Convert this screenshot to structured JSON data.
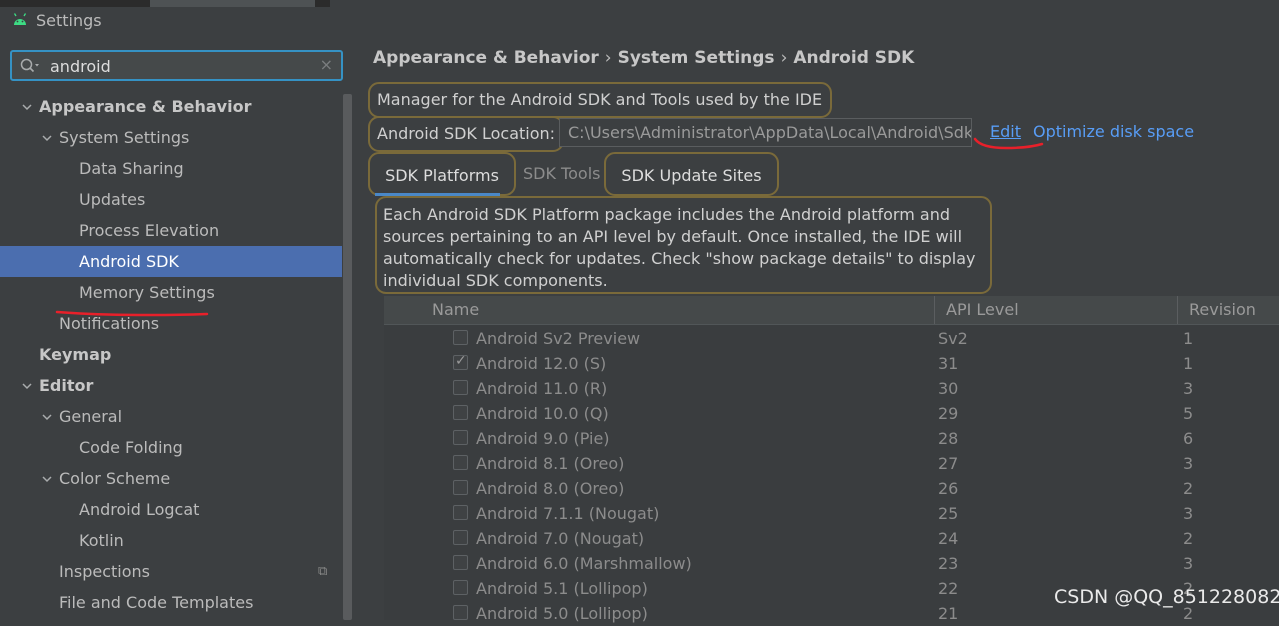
{
  "window": {
    "title": "Settings"
  },
  "search": {
    "value": "android"
  },
  "sidebar": {
    "items": [
      {
        "label": "Appearance & Behavior",
        "level": 0,
        "expanded": true,
        "bold": true
      },
      {
        "label": "System Settings",
        "level": 1,
        "expanded": true
      },
      {
        "label": "Data Sharing",
        "level": 2
      },
      {
        "label": "Updates",
        "level": 2
      },
      {
        "label": "Process Elevation",
        "level": 2
      },
      {
        "label": "Android SDK",
        "level": 2,
        "selected": true
      },
      {
        "label": "Memory Settings",
        "level": 2
      },
      {
        "label": "Notifications",
        "level": 1
      },
      {
        "label": "Keymap",
        "level": 0,
        "bold": true
      },
      {
        "label": "Editor",
        "level": 0,
        "expanded": true,
        "bold": true
      },
      {
        "label": "General",
        "level": 1,
        "expanded": true
      },
      {
        "label": "Code Folding",
        "level": 2
      },
      {
        "label": "Color Scheme",
        "level": 1,
        "expanded": true
      },
      {
        "label": "Android Logcat",
        "level": 2
      },
      {
        "label": "Kotlin",
        "level": 2
      },
      {
        "label": "Inspections",
        "level": 1
      },
      {
        "label": "File and Code Templates",
        "level": 1
      }
    ]
  },
  "breadcrumb": [
    "Appearance & Behavior",
    "System Settings",
    "Android SDK"
  ],
  "main": {
    "description": "Manager for the Android SDK and Tools used by the IDE",
    "sdk_location_label": "Android SDK Location:",
    "sdk_location_value": "C:\\Users\\Administrator\\AppData\\Local\\Android\\Sdk",
    "edit_link": "Edit",
    "optimize_link": "Optimize disk space",
    "tabs": [
      "SDK Platforms",
      "SDK Tools",
      "SDK Update Sites"
    ],
    "info_lines": [
      "Each Android SDK Platform package includes the Android platform and",
      "sources pertaining to an API level by default. Once installed, the IDE will",
      "automatically check for updates. Check \"show package details\" to display",
      "individual SDK components."
    ]
  },
  "table": {
    "columns": [
      "Name",
      "API Level",
      "Revision"
    ],
    "rows": [
      {
        "name": "Android Sv2 Preview",
        "api": "Sv2",
        "rev": "1",
        "checked": false
      },
      {
        "name": "Android 12.0 (S)",
        "api": "31",
        "rev": "1",
        "checked": true
      },
      {
        "name": "Android 11.0 (R)",
        "api": "30",
        "rev": "3",
        "checked": false
      },
      {
        "name": "Android 10.0 (Q)",
        "api": "29",
        "rev": "5",
        "checked": false
      },
      {
        "name": "Android 9.0 (Pie)",
        "api": "28",
        "rev": "6",
        "checked": false
      },
      {
        "name": "Android 8.1 (Oreo)",
        "api": "27",
        "rev": "3",
        "checked": false
      },
      {
        "name": "Android 8.0 (Oreo)",
        "api": "26",
        "rev": "2",
        "checked": false
      },
      {
        "name": "Android 7.1.1 (Nougat)",
        "api": "25",
        "rev": "3",
        "checked": false
      },
      {
        "name": "Android 7.0 (Nougat)",
        "api": "24",
        "rev": "2",
        "checked": false
      },
      {
        "name": "Android 6.0 (Marshmallow)",
        "api": "23",
        "rev": "3",
        "checked": false
      },
      {
        "name": "Android 5.1 (Lollipop)",
        "api": "22",
        "rev": "2",
        "checked": false
      },
      {
        "name": "Android 5.0 (Lollipop)",
        "api": "21",
        "rev": "2",
        "checked": false
      }
    ]
  },
  "watermark": "CSDN @QQ_851228082",
  "colors": {
    "accent": "#4b6eaf",
    "link": "#589df6",
    "annotation_red": "#e8202a",
    "highlight_border": "#7a6a3a"
  }
}
